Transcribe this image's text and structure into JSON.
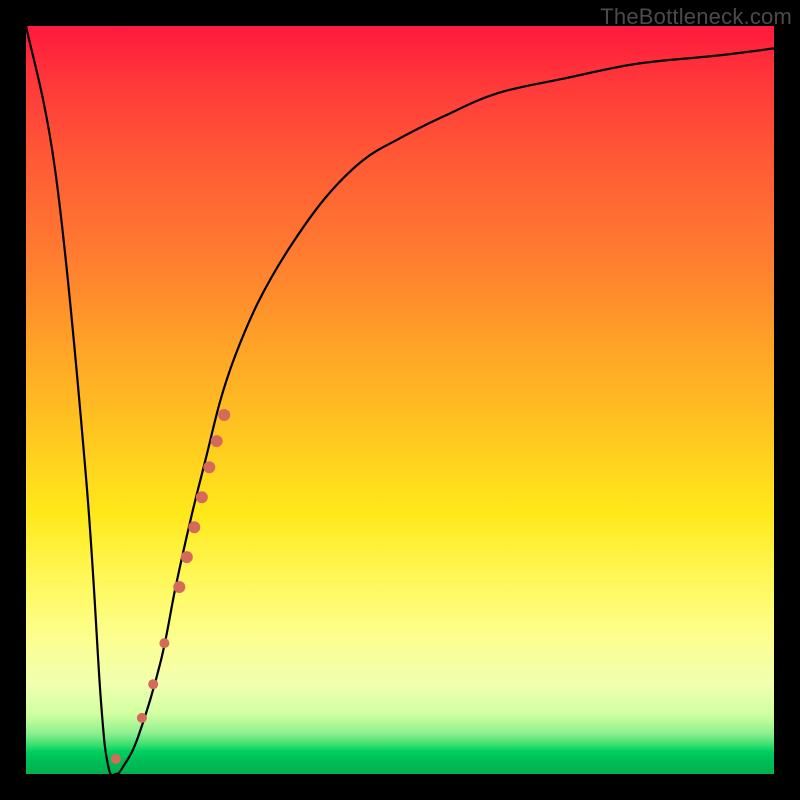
{
  "watermark": "TheBottleneck.com",
  "colors": {
    "frame": "#000000",
    "curve": "#000000",
    "marker": "#d56a5a",
    "gradient_top": "#ff1a3c",
    "gradient_bottom": "#00b050"
  },
  "chart_data": {
    "type": "line",
    "title": "",
    "xlabel": "",
    "ylabel": "",
    "xlim": [
      0,
      100
    ],
    "ylim": [
      0,
      100
    ],
    "grid": false,
    "legend": false,
    "series": [
      {
        "name": "bottleneck-curve",
        "x": [
          0,
          4,
          8,
          10,
          11,
          12,
          13,
          15,
          18,
          20,
          22,
          24,
          26,
          28,
          31,
          35,
          40,
          45,
          50,
          56,
          63,
          72,
          82,
          92,
          100
        ],
        "y": [
          100,
          80,
          40,
          10,
          1,
          0,
          1,
          5,
          15,
          25,
          34,
          42,
          50,
          56,
          63,
          70,
          77,
          82,
          85,
          88,
          91,
          93,
          95,
          96,
          97
        ]
      }
    ],
    "markers": [
      {
        "name": "highlight-min",
        "x": 12.0,
        "y": 2.0,
        "r": 5
      },
      {
        "name": "highlight-dot-a",
        "x": 15.5,
        "y": 7.5,
        "r": 5
      },
      {
        "name": "highlight-dot-b",
        "x": 17.0,
        "y": 12.0,
        "r": 5
      },
      {
        "name": "highlight-dot-c",
        "x": 18.5,
        "y": 17.5,
        "r": 5
      },
      {
        "name": "highlight-seg-1",
        "x": 20.5,
        "y": 25.0,
        "r": 6
      },
      {
        "name": "highlight-seg-2",
        "x": 21.5,
        "y": 29.0,
        "r": 6
      },
      {
        "name": "highlight-seg-3",
        "x": 22.5,
        "y": 33.0,
        "r": 6
      },
      {
        "name": "highlight-seg-4",
        "x": 23.5,
        "y": 37.0,
        "r": 6
      },
      {
        "name": "highlight-seg-5",
        "x": 24.5,
        "y": 41.0,
        "r": 6
      },
      {
        "name": "highlight-seg-6",
        "x": 25.5,
        "y": 44.5,
        "r": 6
      },
      {
        "name": "highlight-seg-7",
        "x": 26.5,
        "y": 48.0,
        "r": 6
      }
    ]
  }
}
